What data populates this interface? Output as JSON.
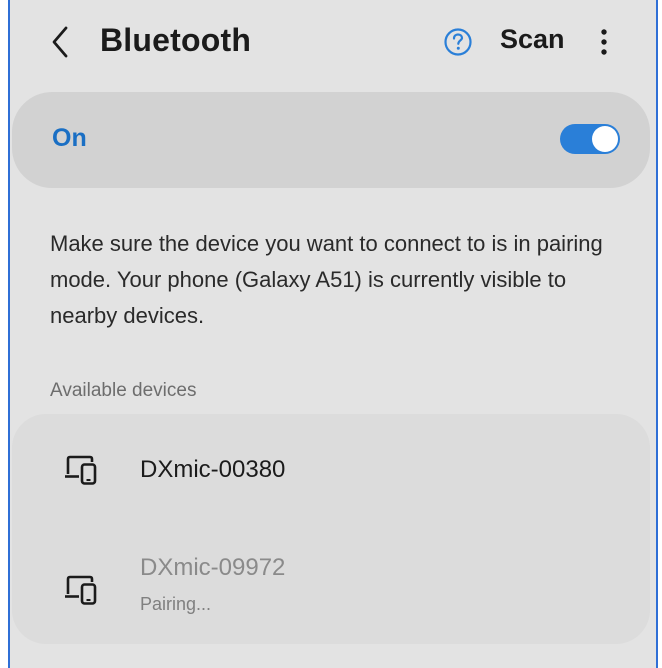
{
  "header": {
    "title": "Bluetooth",
    "scan_label": "Scan"
  },
  "bluetooth_toggle": {
    "label": "On",
    "enabled": true
  },
  "info_text": "Make sure the device you want to connect to is in pairing mode. Your phone (Galaxy A51) is currently visible to nearby devices.",
  "available_devices": {
    "label": "Available devices",
    "devices": [
      {
        "name": "DXmic-00380",
        "status": ""
      },
      {
        "name": "DXmic-09972",
        "status": "Pairing..."
      }
    ]
  },
  "colors": {
    "accent": "#2a7fd8",
    "on_label": "#1a6fc4",
    "background": "#e3e3e3",
    "card": "#d2d2d2"
  },
  "icons": {
    "back": "chevron-left-icon",
    "help": "help-circle-icon",
    "more": "more-vertical-icon",
    "device": "devices-icon"
  }
}
